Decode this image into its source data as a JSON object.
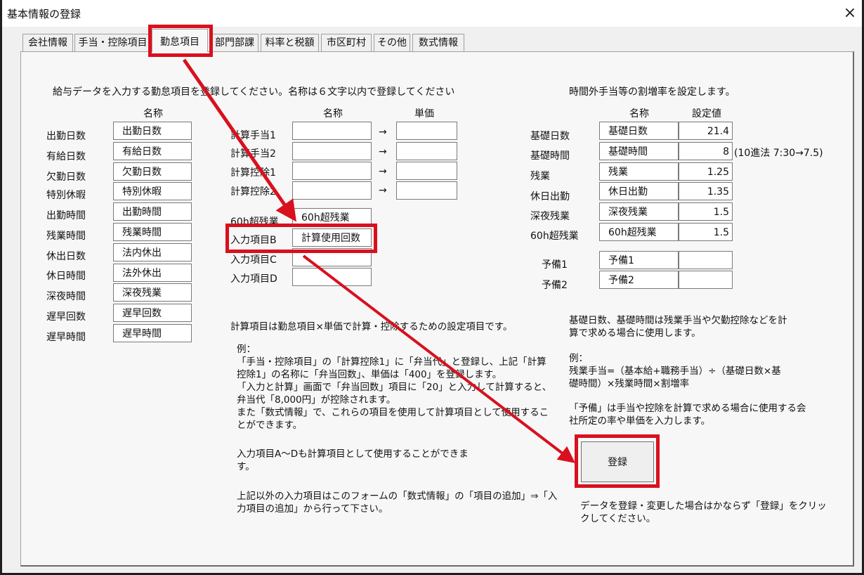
{
  "window": {
    "title": "基本情報の登録",
    "close_label": "×"
  },
  "tabs": [
    "会社情報",
    "手当・控除項目",
    "勤怠項目",
    "部門部課",
    "料率と税額",
    "市区町村",
    "その他",
    "数式情報"
  ],
  "left": {
    "instruction": "給与データを入力する勤怠項目を登録してください。名称は６文字以内で登録してください",
    "col_header": "名称",
    "rows": [
      {
        "label": "出勤日数",
        "value": "出勤日数"
      },
      {
        "label": "有給日数",
        "value": "有給日数"
      },
      {
        "label": "欠勤日数",
        "value": "欠勤日数"
      },
      {
        "label": "特別休暇",
        "value": "特別休暇"
      },
      {
        "label": "出勤時間",
        "value": "出勤時間"
      },
      {
        "label": "残業時間",
        "value": "残業時間"
      },
      {
        "label": "休出日数",
        "value": "法内休出"
      },
      {
        "label": "休日時間",
        "value": "法外休出"
      },
      {
        "label": "深夜時間",
        "value": "深夜残業"
      },
      {
        "label": "遅早回数",
        "value": "遅早回数"
      },
      {
        "label": "遅早時間",
        "value": "遅早時間"
      }
    ]
  },
  "middle": {
    "col_name": "名称",
    "col_price": "単価",
    "arrow": "→",
    "calc_rows": [
      {
        "label": "計算手当1",
        "name": "",
        "price": ""
      },
      {
        "label": "計算手当2",
        "name": "",
        "price": ""
      },
      {
        "label": "計算控除1",
        "name": "",
        "price": ""
      },
      {
        "label": "計算控除2",
        "name": "",
        "price": ""
      }
    ],
    "input_rows": [
      {
        "label": "60h超残業",
        "value": "60h超残業"
      },
      {
        "label": "入力項目B",
        "value": "計算使用回数"
      },
      {
        "label": "入力項目C",
        "value": ""
      },
      {
        "label": "入力項目D",
        "value": ""
      }
    ],
    "explanation": "計算項目は勤怠項目×単価で計算・控除するための設定項目です。",
    "example": "例：\n「手当・控除項目」の「計算控除1」に「弁当代」と登録し、上記「計算\n控除1」の名称に「弁当回数」、単価は「400」を登録します。\n「入力と計算」画面で「弁当回数」項目に「20」と入力して計算すると、\n弁当代「8,000円」が控除されます。\nまた「数式情報」で、これらの項目を使用して計算項目として使用するこ\nとができます。",
    "note_ad": "入力項目A～Dも計算項目として使用することができま\nす。",
    "note_other": "上記以外の入力項目はこのフォームの「数式情報」の「項目の追加」⇒「入\n力項目の追加」から行って下さい。"
  },
  "right": {
    "instruction": "時間外手当等の割増率を設定します。",
    "col_name": "名称",
    "col_value": "設定値",
    "rows": [
      {
        "label": "基礎日数",
        "name": "基礎日数",
        "value": "21.4",
        "note": ""
      },
      {
        "label": "基礎時間",
        "name": "基礎時間",
        "value": "8",
        "note": "(10進法  7:30→7.5)"
      },
      {
        "label": "残業",
        "name": "残業",
        "value": "1.25",
        "note": ""
      },
      {
        "label": "休日出勤",
        "name": "休日出勤",
        "value": "1.35",
        "note": ""
      },
      {
        "label": "深夜残業",
        "name": "深夜残業",
        "value": "1.5",
        "note": ""
      },
      {
        "label": "60h超残業",
        "name": "60h超残業",
        "value": "1.5",
        "note": ""
      }
    ],
    "reserve_rows": [
      {
        "label": "予備1",
        "name": "予備1",
        "value": ""
      },
      {
        "label": "予備2",
        "name": "予備2",
        "value": ""
      }
    ],
    "help1": "基礎日数、基礎時間は残業手当や欠勤控除などを計\n算で求める場合に使用します。",
    "help2": "例：\n残業手当=（基本給+職務手当）÷（基礎日数×基\n礎時間）×残業時間×割増率",
    "help3": "「予備」は手当や控除を計算で求める場合に使用する会\n社所定の率や単価を入力します。",
    "register_label": "登録",
    "register_note": "データを登録・変更した場合はかならず「登録」をクリッ\nクしてください。"
  },
  "colors": {
    "annotation": "#d9101e",
    "form_bg": "#f0f0f0",
    "page_bg": "#f7f7f7"
  }
}
